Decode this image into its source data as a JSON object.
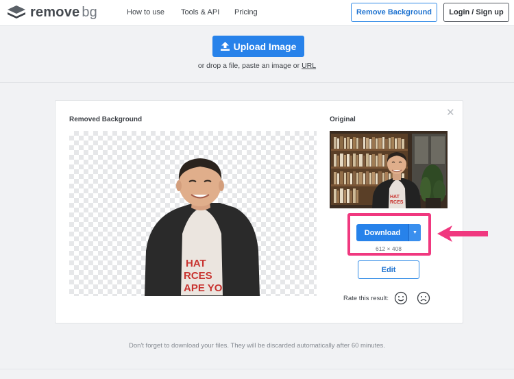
{
  "header": {
    "logo_main": "remove",
    "logo_accent": "bg",
    "nav": [
      "How to use",
      "Tools & API",
      "Pricing"
    ],
    "remove_background_label": "Remove Background",
    "login_label": "Login / Sign up"
  },
  "upload": {
    "button_label": "Upload Image",
    "drop_text_prefix": "or drop a file, paste an image or",
    "drop_link": "URL"
  },
  "result": {
    "removed_title": "Removed Background",
    "original_title": "Original",
    "download_label": "Download",
    "dimensions": "612 × 408",
    "edit_label": "Edit",
    "rate_label": "Rate this result:"
  },
  "footer": {
    "note": "Don't forget to download your files. They will be discarded automatically after 60 minutes."
  },
  "colors": {
    "primary": "#2782ea",
    "highlight": "#f0387f"
  },
  "icons": [
    "logo-icon",
    "upload-icon",
    "close-icon",
    "chevron-down-icon",
    "smiley-icon",
    "frown-icon",
    "arrow-icon"
  ]
}
